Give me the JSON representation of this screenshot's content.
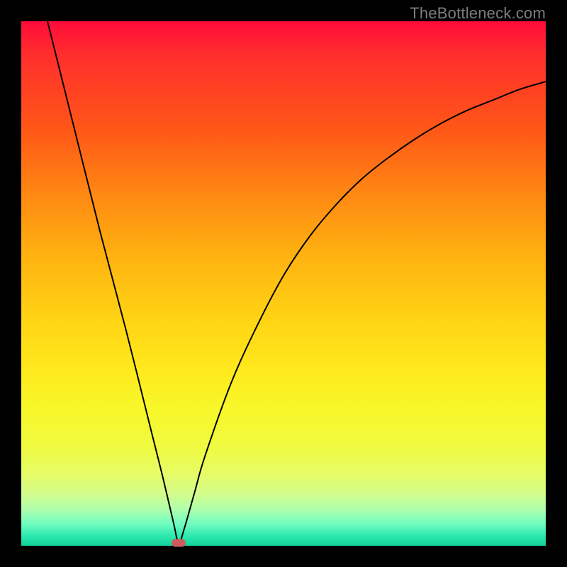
{
  "watermark": {
    "text": "TheBottleneck.com"
  },
  "chart_data": {
    "type": "line",
    "title": "",
    "xlabel": "",
    "ylabel": "",
    "xlim": [
      0,
      100
    ],
    "ylim": [
      0,
      100
    ],
    "grid": false,
    "legend": false,
    "series": [
      {
        "name": "bottleneck-curve",
        "x": [
          5,
          10,
          15,
          20,
          25,
          27,
          29,
          30,
          31,
          33,
          35,
          40,
          45,
          50,
          55,
          60,
          65,
          70,
          75,
          80,
          85,
          90,
          95,
          100
        ],
        "y": [
          100,
          80,
          60,
          41,
          21,
          13,
          4.5,
          0.5,
          3,
          10,
          17,
          31,
          42,
          51.5,
          59,
          65,
          70,
          74,
          77.5,
          80.5,
          83,
          85,
          87,
          88.5
        ],
        "color": "#000000",
        "line_width": 2
      }
    ],
    "annotations": [
      {
        "name": "optimal-marker",
        "x": 30,
        "y": 0.5,
        "shape": "pill",
        "color": "#cc5c5c"
      }
    ],
    "background": {
      "type": "vertical-gradient",
      "stops": [
        {
          "pos": 0.0,
          "color": "#ff0a3a"
        },
        {
          "pos": 0.2,
          "color": "#ff5518"
        },
        {
          "pos": 0.44,
          "color": "#ffb010"
        },
        {
          "pos": 0.66,
          "color": "#ffe81c"
        },
        {
          "pos": 0.86,
          "color": "#e7fc64"
        },
        {
          "pos": 1.0,
          "color": "#12d29a"
        }
      ]
    }
  },
  "layout": {
    "frame_size": 800,
    "plot_inset": 30,
    "plot_size": 740
  }
}
